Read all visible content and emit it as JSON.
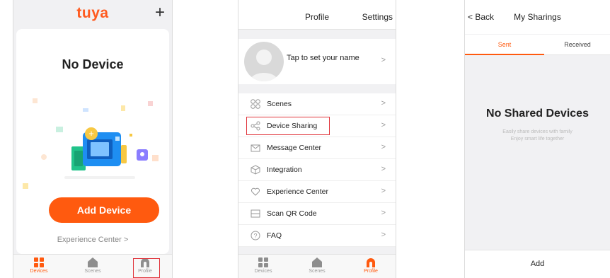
{
  "screen_home": {
    "logo_text": "tuya",
    "empty_title": "No Device",
    "add_device_label": "Add Device",
    "experience_link": "Experience Center >",
    "tabs": [
      {
        "label": "Devices",
        "icon": "grid-icon",
        "active": true
      },
      {
        "label": "Scenes",
        "icon": "home-icon",
        "active": false
      },
      {
        "label": "Profile",
        "icon": "profile-icon",
        "active": false
      }
    ]
  },
  "screen_profile": {
    "title": "Profile",
    "settings_label": "Settings",
    "username_prompt": "Tap to set your name",
    "menu": [
      {
        "label": "Scenes",
        "icon": "scenes-icon"
      },
      {
        "label": "Device Sharing",
        "icon": "share-icon"
      },
      {
        "label": "Message Center",
        "icon": "mail-icon"
      },
      {
        "label": "Integration",
        "icon": "cube-icon"
      },
      {
        "label": "Experience Center",
        "icon": "heart-icon"
      },
      {
        "label": "Scan QR Code",
        "icon": "scan-icon"
      },
      {
        "label": "FAQ",
        "icon": "question-icon"
      }
    ],
    "tabs": [
      {
        "label": "Devices",
        "icon": "grid-icon",
        "active": false
      },
      {
        "label": "Scenes",
        "icon": "home-icon",
        "active": false
      },
      {
        "label": "Profile",
        "icon": "profile-icon",
        "active": true
      }
    ]
  },
  "screen_sharings": {
    "back_label": "Back",
    "title": "My Sharings",
    "tab_sent": "Sent",
    "tab_received": "Received",
    "empty_title": "No Shared Devices",
    "empty_line1": "Easily share devices with family",
    "empty_line2": "Enjoy smart life together",
    "add_label": "Add"
  },
  "colors": {
    "accent": "#ff5a0f",
    "highlight_box": "#e0333a",
    "background": "#f1f1f3"
  }
}
